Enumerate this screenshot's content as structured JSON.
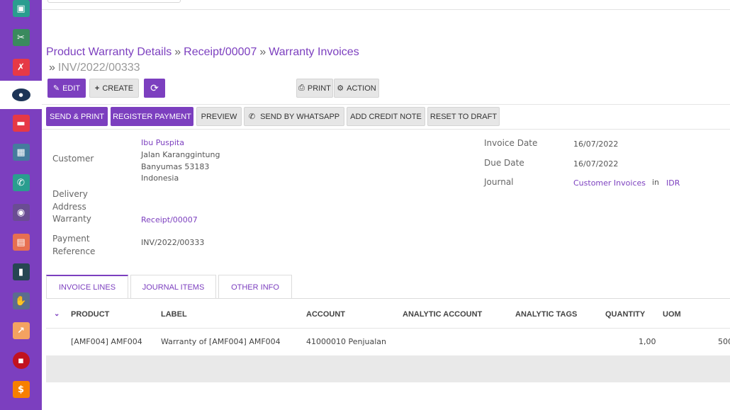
{
  "sidebar": {
    "apps": [
      {
        "icon": "dashboard-icon",
        "color": "#2a9d8f",
        "glyph": "▣"
      },
      {
        "icon": "tools-icon",
        "color": "#3a8a5e",
        "glyph": "✂"
      },
      {
        "icon": "runner-icon",
        "color": "#e63946",
        "glyph": "✗"
      },
      {
        "icon": "brand-logo-icon",
        "color": "#1d3557",
        "glyph": "●"
      },
      {
        "icon": "folder-icon",
        "color": "#e63946",
        "glyph": "▬"
      },
      {
        "icon": "inventory-icon",
        "color": "#457b9d",
        "glyph": "▦"
      },
      {
        "icon": "whatsapp-icon",
        "color": "#2a9d8f",
        "glyph": "✆"
      },
      {
        "icon": "camera-icon",
        "color": "#6a4c93",
        "glyph": "◉"
      },
      {
        "icon": "messages-icon",
        "color": "#e76f51",
        "glyph": "▤"
      },
      {
        "icon": "document-icon",
        "color": "#264653",
        "glyph": "▮"
      },
      {
        "icon": "handshake-icon",
        "color": "#5b6c8f",
        "glyph": "✋"
      },
      {
        "icon": "chart-icon",
        "color": "#f4a261",
        "glyph": "↗"
      },
      {
        "icon": "notes-icon",
        "color": "#c1121f",
        "glyph": "▪"
      },
      {
        "icon": "invoice-icon",
        "color": "#f77f00",
        "glyph": "$"
      }
    ]
  },
  "breadcrumb": {
    "items": [
      "Product Warranty Details",
      "Receipt/00007",
      "Warranty Invoices"
    ],
    "current": "INV/2022/00333",
    "separator": "»"
  },
  "toolbar": {
    "edit": "EDIT",
    "create": "CREATE",
    "print": "PRINT",
    "action": "ACTION"
  },
  "statusbar": {
    "send_print": "SEND & PRINT",
    "register_payment": "REGISTER PAYMENT",
    "preview": "PREVIEW",
    "send_whatsapp": "SEND BY WHATSAPP",
    "add_credit_note": "ADD CREDIT NOTE",
    "reset_to_draft": "RESET TO DRAFT"
  },
  "form": {
    "customer_label": "Customer",
    "customer_name": "Ibu Puspita",
    "customer_addr1": "Jalan Karanggintung",
    "customer_addr2": "Banyumas 53183",
    "customer_addr3": "Indonesia",
    "delivery_label_1": "Delivery",
    "delivery_label_2": "Address",
    "warranty_label": "Warranty",
    "warranty_value": "Receipt/00007",
    "payment_label_1": "Payment",
    "payment_label_2": "Reference",
    "payment_value": "INV/2022/00333",
    "invoice_date_label": "Invoice Date",
    "invoice_date": "16/07/2022",
    "due_date_label": "Due Date",
    "due_date": "16/07/2022",
    "journal_label": "Journal",
    "journal_value": "Customer Invoices",
    "journal_in": "in",
    "currency": "IDR"
  },
  "tabs": [
    "INVOICE LINES",
    "JOURNAL ITEMS",
    "OTHER INFO"
  ],
  "table": {
    "headers": [
      "PRODUCT",
      "LABEL",
      "ACCOUNT",
      "ANALYTIC ACCOUNT",
      "ANALYTIC TAGS",
      "QUANTITY",
      "UOM"
    ],
    "rows": [
      {
        "product": "[AMF004] AMF004",
        "label": "Warranty of [AMF004] AMF004",
        "account": "41000010 Penjualan",
        "quantity": "1,00",
        "price": "500"
      }
    ]
  },
  "colors": {
    "accent": "#7c3fbf"
  }
}
